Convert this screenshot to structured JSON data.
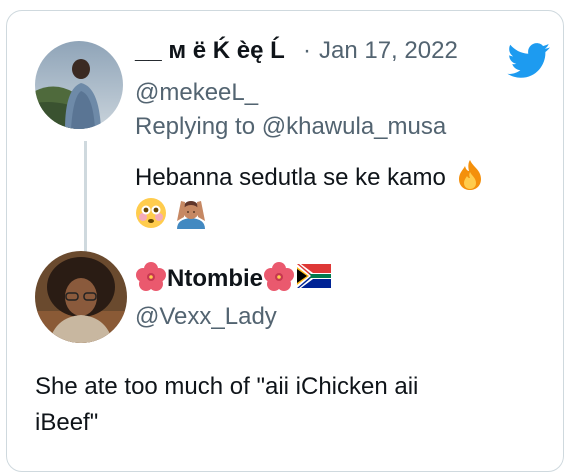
{
  "tweet": {
    "display_name": "__ ᴍ ë Ḱ èę Ĺ",
    "separator": "·",
    "date": "Jan 17, 2022",
    "handle": "@mekeeL_",
    "replying_prefix": "Replying to ",
    "replying_to": "@khawula_musa",
    "text": "Hebanna sedutla se ke kamo",
    "emoji_line1": [
      "fire-emoji"
    ],
    "emoji_line2": [
      "flushed-face-emoji",
      "man-facepalming-emoji"
    ]
  },
  "quoted": {
    "display_name": "Ntombie",
    "handle": "@Vexx_Lady",
    "name_emojis": [
      "hibiscus-emoji",
      "hibiscus-emoji",
      "south-africa-flag-emoji"
    ]
  },
  "reply": {
    "line1": "She ate too much of \"aii iChicken aii",
    "line2": "iBeef\""
  },
  "colors": {
    "twitter_blue": "#1d9bf0",
    "text_primary": "#0f1419",
    "text_muted": "#536471",
    "border": "#cfd9de"
  }
}
